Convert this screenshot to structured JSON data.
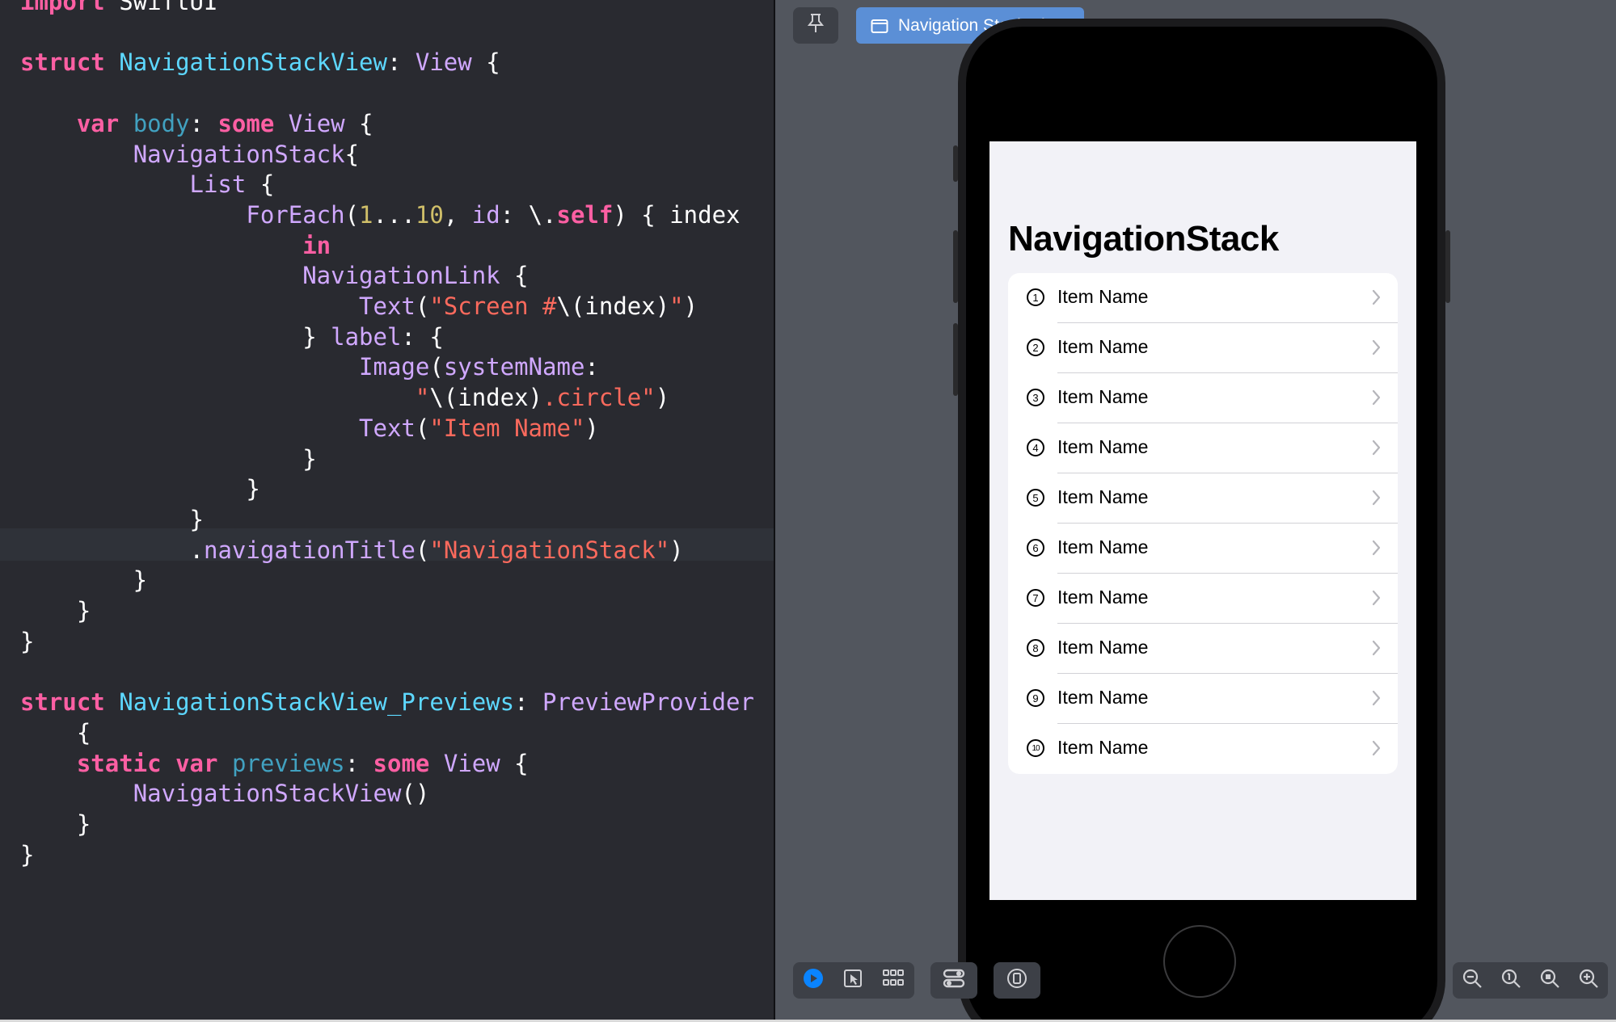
{
  "editor": {
    "lines": [
      [
        {
          "t": "import",
          "c": "kw"
        },
        {
          "t": " SwiftUI",
          "c": "pl"
        }
      ],
      [],
      [
        {
          "t": "struct",
          "c": "kw"
        },
        {
          "t": " ",
          "c": "pl"
        },
        {
          "t": "NavigationStackView",
          "c": "ty"
        },
        {
          "t": ": ",
          "c": "pl"
        },
        {
          "t": "View",
          "c": "id"
        },
        {
          "t": " {",
          "c": "pl"
        }
      ],
      [],
      [
        {
          "t": "    ",
          "c": "pl"
        },
        {
          "t": "var",
          "c": "kw"
        },
        {
          "t": " ",
          "c": "pl"
        },
        {
          "t": "body",
          "c": "pr"
        },
        {
          "t": ": ",
          "c": "pl"
        },
        {
          "t": "some",
          "c": "kw"
        },
        {
          "t": " ",
          "c": "pl"
        },
        {
          "t": "View",
          "c": "id"
        },
        {
          "t": " {",
          "c": "pl"
        }
      ],
      [
        {
          "t": "        ",
          "c": "pl"
        },
        {
          "t": "NavigationStack",
          "c": "id"
        },
        {
          "t": "{",
          "c": "pl"
        }
      ],
      [
        {
          "t": "            ",
          "c": "pl"
        },
        {
          "t": "List",
          "c": "id"
        },
        {
          "t": " {",
          "c": "pl"
        }
      ],
      [
        {
          "t": "                ",
          "c": "pl"
        },
        {
          "t": "ForEach",
          "c": "id"
        },
        {
          "t": "(",
          "c": "pl"
        },
        {
          "t": "1",
          "c": "nu"
        },
        {
          "t": "...",
          "c": "pl"
        },
        {
          "t": "10",
          "c": "nu"
        },
        {
          "t": ", ",
          "c": "pl"
        },
        {
          "t": "id",
          "c": "id"
        },
        {
          "t": ": \\.",
          "c": "pl"
        },
        {
          "t": "self",
          "c": "kw"
        },
        {
          "t": ") { index",
          "c": "pl"
        }
      ],
      [
        {
          "t": "                    ",
          "c": "pl"
        },
        {
          "t": "in",
          "c": "kw"
        }
      ],
      [
        {
          "t": "                    ",
          "c": "pl"
        },
        {
          "t": "NavigationLink",
          "c": "id"
        },
        {
          "t": " {",
          "c": "pl"
        }
      ],
      [
        {
          "t": "                        ",
          "c": "pl"
        },
        {
          "t": "Text",
          "c": "id"
        },
        {
          "t": "(",
          "c": "pl"
        },
        {
          "t": "\"Screen #",
          "c": "st"
        },
        {
          "t": "\\(index)",
          "c": "pl"
        },
        {
          "t": "\"",
          "c": "st"
        },
        {
          "t": ")",
          "c": "pl"
        }
      ],
      [
        {
          "t": "                    } ",
          "c": "pl"
        },
        {
          "t": "label",
          "c": "id"
        },
        {
          "t": ": {",
          "c": "pl"
        }
      ],
      [
        {
          "t": "                        ",
          "c": "pl"
        },
        {
          "t": "Image",
          "c": "id"
        },
        {
          "t": "(",
          "c": "pl"
        },
        {
          "t": "systemName",
          "c": "id"
        },
        {
          "t": ":",
          "c": "pl"
        }
      ],
      [
        {
          "t": "                            ",
          "c": "pl"
        },
        {
          "t": "\"",
          "c": "st"
        },
        {
          "t": "\\(index)",
          "c": "pl"
        },
        {
          "t": ".circle\"",
          "c": "st"
        },
        {
          "t": ")",
          "c": "pl"
        }
      ],
      [
        {
          "t": "                        ",
          "c": "pl"
        },
        {
          "t": "Text",
          "c": "id"
        },
        {
          "t": "(",
          "c": "pl"
        },
        {
          "t": "\"Item Name\"",
          "c": "st"
        },
        {
          "t": ")",
          "c": "pl"
        }
      ],
      [
        {
          "t": "                    }",
          "c": "pl"
        }
      ],
      [
        {
          "t": "                }",
          "c": "pl"
        }
      ],
      [
        {
          "t": "            }",
          "c": "pl"
        }
      ],
      [
        {
          "t": "            .",
          "c": "pl"
        },
        {
          "t": "navigationTitle",
          "c": "id"
        },
        {
          "t": "(",
          "c": "pl"
        },
        {
          "t": "\"NavigationStack\"",
          "c": "st"
        },
        {
          "t": ")",
          "c": "pl"
        }
      ],
      [
        {
          "t": "        }",
          "c": "pl"
        }
      ],
      [
        {
          "t": "    }",
          "c": "pl"
        }
      ],
      [
        {
          "t": "}",
          "c": "pl"
        }
      ],
      [],
      [
        {
          "t": "struct",
          "c": "kw"
        },
        {
          "t": " ",
          "c": "pl"
        },
        {
          "t": "NavigationStackView_Previews",
          "c": "ty"
        },
        {
          "t": ": ",
          "c": "pl"
        },
        {
          "t": "PreviewProvider",
          "c": "id"
        }
      ],
      [
        {
          "t": "    {",
          "c": "pl"
        }
      ],
      [
        {
          "t": "    ",
          "c": "pl"
        },
        {
          "t": "static",
          "c": "kw"
        },
        {
          "t": " ",
          "c": "pl"
        },
        {
          "t": "var",
          "c": "kw"
        },
        {
          "t": " ",
          "c": "pl"
        },
        {
          "t": "previews",
          "c": "pr"
        },
        {
          "t": ": ",
          "c": "pl"
        },
        {
          "t": "some",
          "c": "kw"
        },
        {
          "t": " ",
          "c": "pl"
        },
        {
          "t": "View",
          "c": "id"
        },
        {
          "t": " {",
          "c": "pl"
        }
      ],
      [
        {
          "t": "        ",
          "c": "pl"
        },
        {
          "t": "NavigationStackView",
          "c": "id"
        },
        {
          "t": "()",
          "c": "pl"
        }
      ],
      [
        {
          "t": "    }",
          "c": "pl"
        }
      ],
      [
        {
          "t": "}",
          "c": "pl"
        }
      ]
    ]
  },
  "canvas": {
    "pin_icon": "pin-icon",
    "preview_tab_label": "Navigation Stack View",
    "preview": {
      "nav_title": "NavigationStack",
      "items": [
        {
          "num": "1",
          "label": "Item Name"
        },
        {
          "num": "2",
          "label": "Item Name"
        },
        {
          "num": "3",
          "label": "Item Name"
        },
        {
          "num": "4",
          "label": "Item Name"
        },
        {
          "num": "5",
          "label": "Item Name"
        },
        {
          "num": "6",
          "label": "Item Name"
        },
        {
          "num": "7",
          "label": "Item Name"
        },
        {
          "num": "8",
          "label": "Item Name"
        },
        {
          "num": "9",
          "label": "Item Name"
        },
        {
          "num": "10",
          "label": "Item Name"
        }
      ]
    },
    "bottom_toolbar": {
      "mode_icons": [
        "live-mode-icon",
        "selectable-mode-icon",
        "grid-icon"
      ],
      "variants_icon": "variants-icon",
      "device_icon": "device-settings-icon",
      "zoom_icons": [
        "zoom-out-icon",
        "zoom-to-100-icon",
        "zoom-to-fit-icon",
        "zoom-in-icon"
      ]
    }
  },
  "colors": {
    "editor_bg": "#292a30",
    "keyword": "#fc5fa3",
    "type_decl": "#5dd8ff",
    "type_ref": "#d0a8ff",
    "string": "#fc6a5d",
    "number": "#d0bf69",
    "canvas_bg": "#52565e",
    "tab_accent": "#5b8fd6",
    "live_accent": "#0a84ff"
  }
}
